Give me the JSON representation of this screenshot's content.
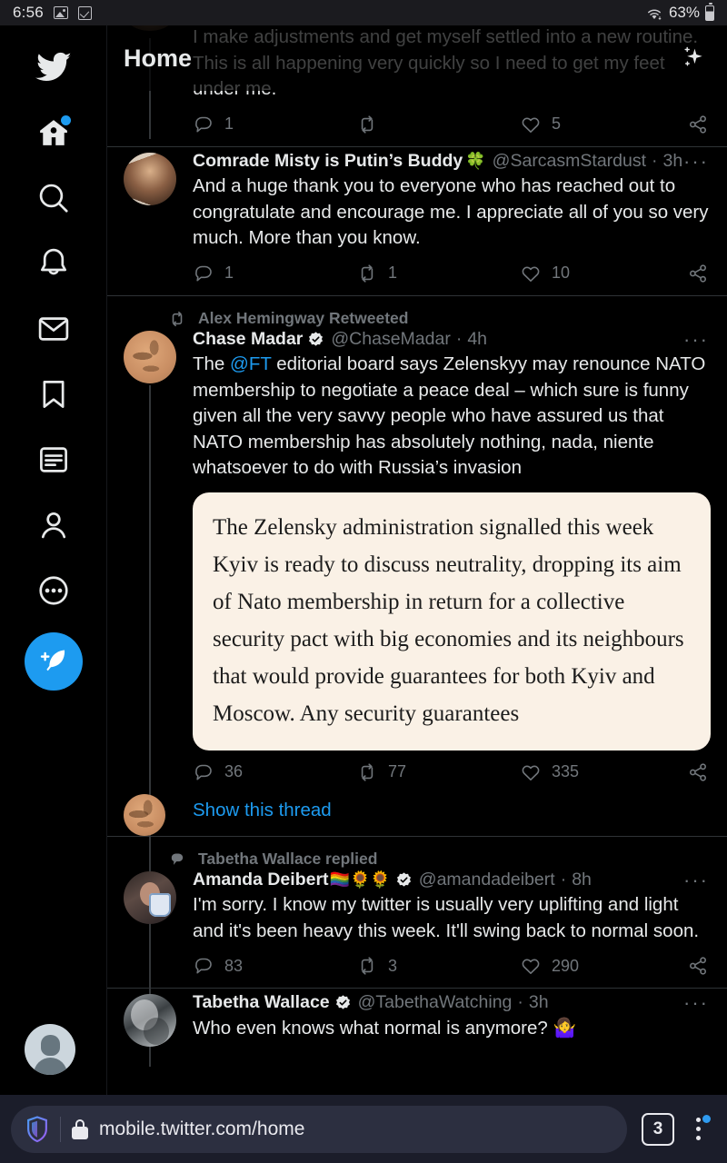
{
  "status_bar": {
    "time": "6:56",
    "battery_percent": "63%",
    "icons": [
      "image-icon",
      "checkbox-icon",
      "wifi-icon",
      "battery-icon"
    ]
  },
  "sidebar": {
    "items": [
      {
        "name": "twitter-logo",
        "label": "Twitter"
      },
      {
        "name": "home",
        "label": "Home",
        "badge": true
      },
      {
        "name": "search",
        "label": "Search"
      },
      {
        "name": "notifications",
        "label": "Notifications"
      },
      {
        "name": "messages",
        "label": "Messages"
      },
      {
        "name": "bookmarks",
        "label": "Bookmarks"
      },
      {
        "name": "lists",
        "label": "Lists"
      },
      {
        "name": "profile",
        "label": "Profile"
      },
      {
        "name": "more",
        "label": "More"
      }
    ],
    "compose_label": "Tweet",
    "account_avatar": "default-avatar"
  },
  "header": {
    "title": "Home",
    "sparkle_label": "Top Tweets"
  },
  "accent_colors": {
    "twitter_blue": "#1d9bf0",
    "text_primary": "#e7e9ea",
    "text_secondary": "#71767b",
    "border": "#2f3336",
    "quote_card_bg": "#faf1e6"
  },
  "tweets": [
    {
      "id": "tweet-partial-top",
      "faded": true,
      "text": "This news obviously means I'm going to have to reconsider my other shows and reschedule some things. Please be patient as I make adjustments and get myself settled into a new routine. This is all happening very quickly so I need to get my feet under me.",
      "replies": "1",
      "retweets": "",
      "likes": "5"
    },
    {
      "id": "tweet-misty",
      "display_name": "Comrade Misty is Putin’s Buddy",
      "name_emoji": "🍀",
      "verified": false,
      "handle": "@SarcasmStardust",
      "time": "3h",
      "text": "And a huge thank you to everyone who has reached out to congratulate and encourage me. I appreciate all of you so very much. More than you know.",
      "replies": "1",
      "retweets": "1",
      "likes": "10"
    },
    {
      "id": "tweet-chase-madar",
      "context_label": "Alex Hemingway Retweeted",
      "context_icon": "retweet-icon",
      "display_name": "Chase Madar",
      "verified": true,
      "handle": "@ChaseMadar",
      "time": "4h",
      "text_before_mention": "The ",
      "mention": "@FT",
      "text_after_mention": " editorial board says Zelenskyy may renounce NATO membership to negotiate a peace deal – which sure is funny given all the very savvy people who have assured us that NATO membership has absolutely nothing, nada, niente whatsoever to do with Russia’s invasion",
      "quote_card_text": "The Zelensky administration signalled this week Kyiv is ready to discuss neutrality, dropping its aim of Nato membership in return for a collective security pact with big economies and its neighbours that would provide guarantees for both Kyiv and Moscow. Any security guarantees",
      "replies": "36",
      "retweets": "77",
      "likes": "335",
      "show_thread": "Show this thread"
    },
    {
      "id": "tweet-amanda-deibert",
      "context_label": "Tabetha Wallace replied",
      "context_icon": "reply-icon",
      "display_name": "Amanda Deibert",
      "name_emoji": "🏳️‍🌈🌻🌻",
      "verified": true,
      "handle": "@amandadeibert",
      "time": "8h",
      "text": "I'm sorry. I know my twitter is usually very uplifting and light and it's been heavy this week. It'll swing back to normal soon.",
      "replies": "83",
      "retweets": "3",
      "likes": "290"
    },
    {
      "id": "tweet-tabetha-wallace",
      "display_name": "Tabetha Wallace",
      "verified": true,
      "handle": "@TabethaWatching",
      "time": "3h",
      "text": "Who even knows what normal is anymore? 🤷‍♀️"
    }
  ],
  "browser_bar": {
    "url": "mobile.twitter.com/home",
    "tab_count": "3",
    "shield_label": "Brave Shields",
    "lock_label": "Secure connection",
    "menu_label": "More options",
    "menu_badge": true
  }
}
